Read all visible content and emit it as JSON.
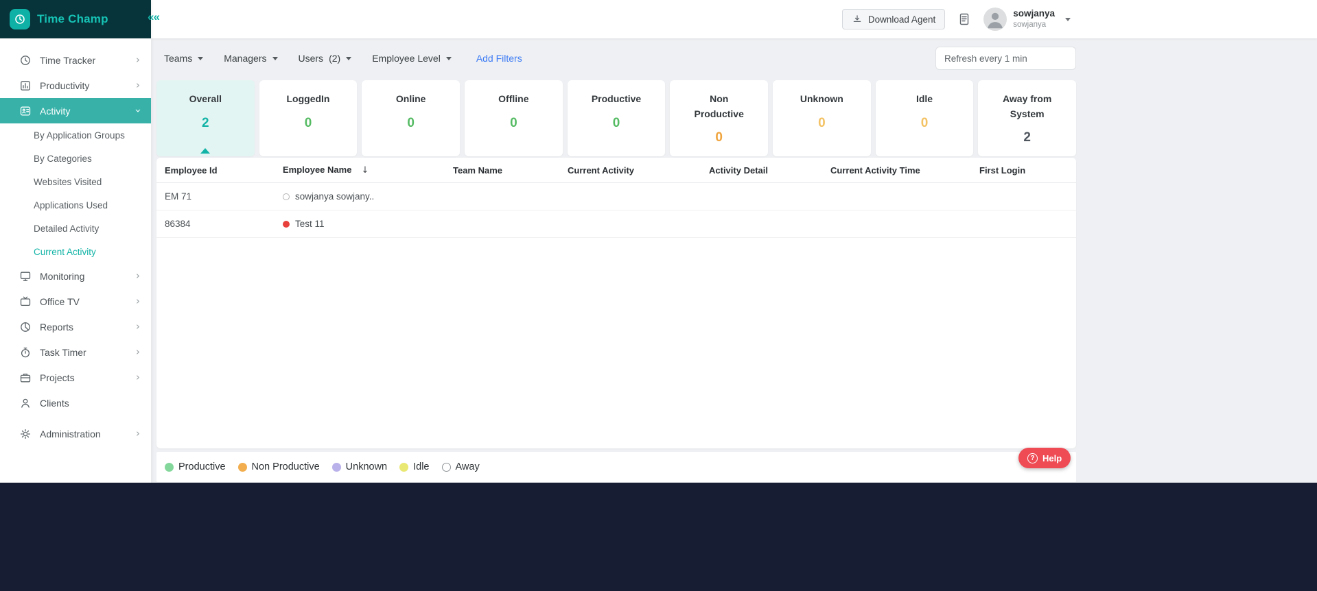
{
  "colors": {
    "brand_teal": "#12b3a6",
    "logo_bar_bg": "#07343a",
    "active_item_bg": "#38b2a9",
    "content_bg": "#eef0f3",
    "bottom_strip": "#171d33",
    "green_value": "#55bb63",
    "orange_value": "#f0a43e",
    "amber_value": "#f3c264",
    "dark_value": "#4f565e",
    "link_blue": "#3d7bf5",
    "help_red": "#ee4b55",
    "offline_dot_red": "#e8413c"
  },
  "sidebar": {
    "brand": "Time Champ",
    "collapse_icon": "««",
    "items": [
      {
        "label": "Time Tracker"
      },
      {
        "label": "Productivity"
      },
      {
        "label": "Activity"
      },
      {
        "label": "Monitoring"
      },
      {
        "label": "Office TV"
      },
      {
        "label": "Reports"
      },
      {
        "label": "Task Timer"
      },
      {
        "label": "Projects"
      },
      {
        "label": "Clients"
      },
      {
        "label": "Administration"
      }
    ],
    "activity_subitems": [
      {
        "label": "By Application Groups"
      },
      {
        "label": "By Categories"
      },
      {
        "label": "Websites Visited"
      },
      {
        "label": "Applications Used"
      },
      {
        "label": "Detailed Activity"
      },
      {
        "label": "Current Activity"
      }
    ]
  },
  "topbar": {
    "download_agent_label": "Download Agent",
    "user_name": "sowjanya",
    "user_subname": "sowjanya"
  },
  "filters": {
    "teams_label": "Teams",
    "managers_label": "Managers",
    "users_label": "Users",
    "users_count": "(2)",
    "employee_level_label": "Employee Level",
    "add_filters_label": "Add Filters",
    "refresh_value": "Refresh every 1 min"
  },
  "status_cards": [
    {
      "label": "Overall",
      "value": "2"
    },
    {
      "label": "LoggedIn",
      "value": "0"
    },
    {
      "label": "Online",
      "value": "0"
    },
    {
      "label": "Offline",
      "value": "0"
    },
    {
      "label": "Productive",
      "value": "0"
    },
    {
      "label": "Non Productive",
      "value": "0"
    },
    {
      "label": "Unknown",
      "value": "0"
    },
    {
      "label": "Idle",
      "value": "0"
    },
    {
      "label": "Away from System",
      "value": "2"
    }
  ],
  "table": {
    "headers": {
      "employee_id": "Employee Id",
      "employee_name": "Employee Name",
      "sort_icon": "↓",
      "team_name": "Team Name",
      "current_activity": "Current Activity",
      "activity_detail": "Activity Detail",
      "current_activity_time": "Current Activity Time",
      "first_login": "First Login"
    },
    "rows": [
      {
        "employee_id": "EM 71",
        "employee_name": "sowjanya sowjany..",
        "status": "away"
      },
      {
        "employee_id": "86384",
        "employee_name": "Test 11",
        "status": "offline"
      }
    ]
  },
  "legend": [
    {
      "label": "Productive",
      "color": "#84d79b"
    },
    {
      "label": "Non Productive",
      "color": "#f2ae4e"
    },
    {
      "label": "Unknown",
      "color": "#b9b1ea"
    },
    {
      "label": "Idle",
      "color": "#e9e873"
    },
    {
      "label": "Away",
      "color": "hollow"
    }
  ],
  "help_label": "Help"
}
